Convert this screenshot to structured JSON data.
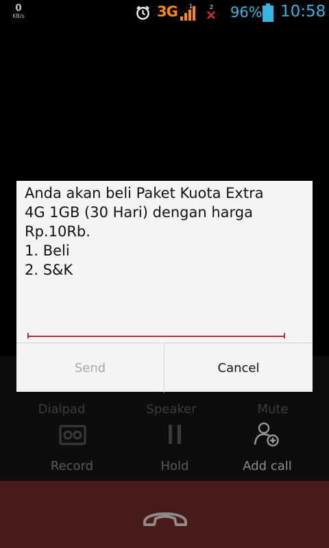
{
  "status_bar": {
    "kb_value": "0",
    "kb_unit": "KB/s",
    "alarm_icon": "alarm-clock-icon",
    "network_type": "3G",
    "sim1_label": "1",
    "sim2_label": "2",
    "battery_percent": "96%",
    "battery_icon": "battery-icon",
    "time": "10:58",
    "colors": {
      "network": "#ff8a00",
      "accent": "#33b5e5",
      "no_signal": "#d32f2f"
    }
  },
  "ussd_dialog": {
    "message": "Anda akan beli Paket Kuota Extra\n4G 1GB (30 Hari) dengan harga\nRp.10Rb.\n1. Beli\n2. S&K",
    "input_value": "",
    "send_label": "Send",
    "cancel_label": "Cancel"
  },
  "call_controls": {
    "dialpad_label": "Dialpad",
    "speaker_label": "Speaker",
    "mute_label": "Mute",
    "record_label": "Record",
    "hold_label": "Hold",
    "add_call_label": "Add call",
    "end_call_color": "#4a1a1a"
  }
}
